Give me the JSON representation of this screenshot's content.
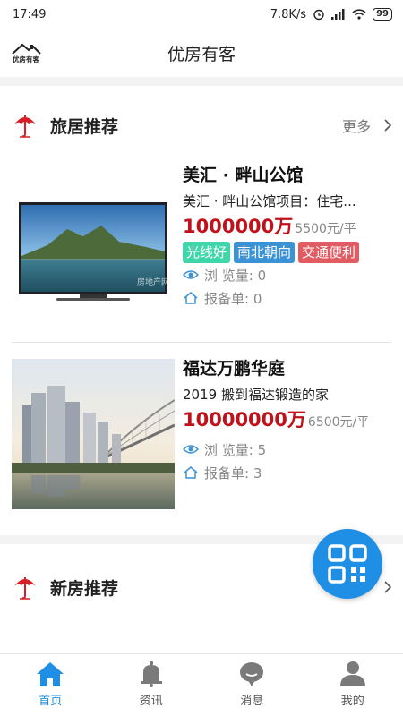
{
  "status_bar": {
    "time": "17:49",
    "network_speed": "7.8K/s",
    "battery": "99"
  },
  "header": {
    "title": "优房有客",
    "logo_text": "优房有客"
  },
  "sections": [
    {
      "title": "旅居推荐",
      "more_label": "更多"
    },
    {
      "title": "新房推荐"
    }
  ],
  "listings": [
    {
      "title": "美汇 · 畔山公馆",
      "description": "美汇 · 畔山公馆项目：住宅...",
      "price": "1000000万",
      "unit_price": "5500元/平",
      "tags": [
        {
          "label": "光线好",
          "color": "#3fd7a9"
        },
        {
          "label": "南北朝向",
          "color": "#3b93d6"
        },
        {
          "label": "交通便利",
          "color": "#e15b63"
        }
      ],
      "views_label": "浏 览量: 0",
      "reports_label": "报备单: 0",
      "image_watermark": "房地产网"
    },
    {
      "title": "福达万鹏华庭",
      "description": "2019 搬到福达锻造的家",
      "price": "10000000万",
      "unit_price": "6500元/平",
      "views_label": "浏 览量: 5",
      "reports_label": "报备单: 3"
    }
  ],
  "tabbar": {
    "items": [
      {
        "label": "首页",
        "icon": "home-icon",
        "active": true
      },
      {
        "label": "资讯",
        "icon": "bell-icon",
        "active": false
      },
      {
        "label": "消息",
        "icon": "chat-bubble-icon",
        "active": false
      },
      {
        "label": "我的",
        "icon": "user-icon",
        "active": false
      }
    ],
    "active_color": "#1e8fe4"
  },
  "colors": {
    "accent": "#1e8fe4",
    "price": "#c1121c",
    "section_icon": "#d61f26"
  }
}
